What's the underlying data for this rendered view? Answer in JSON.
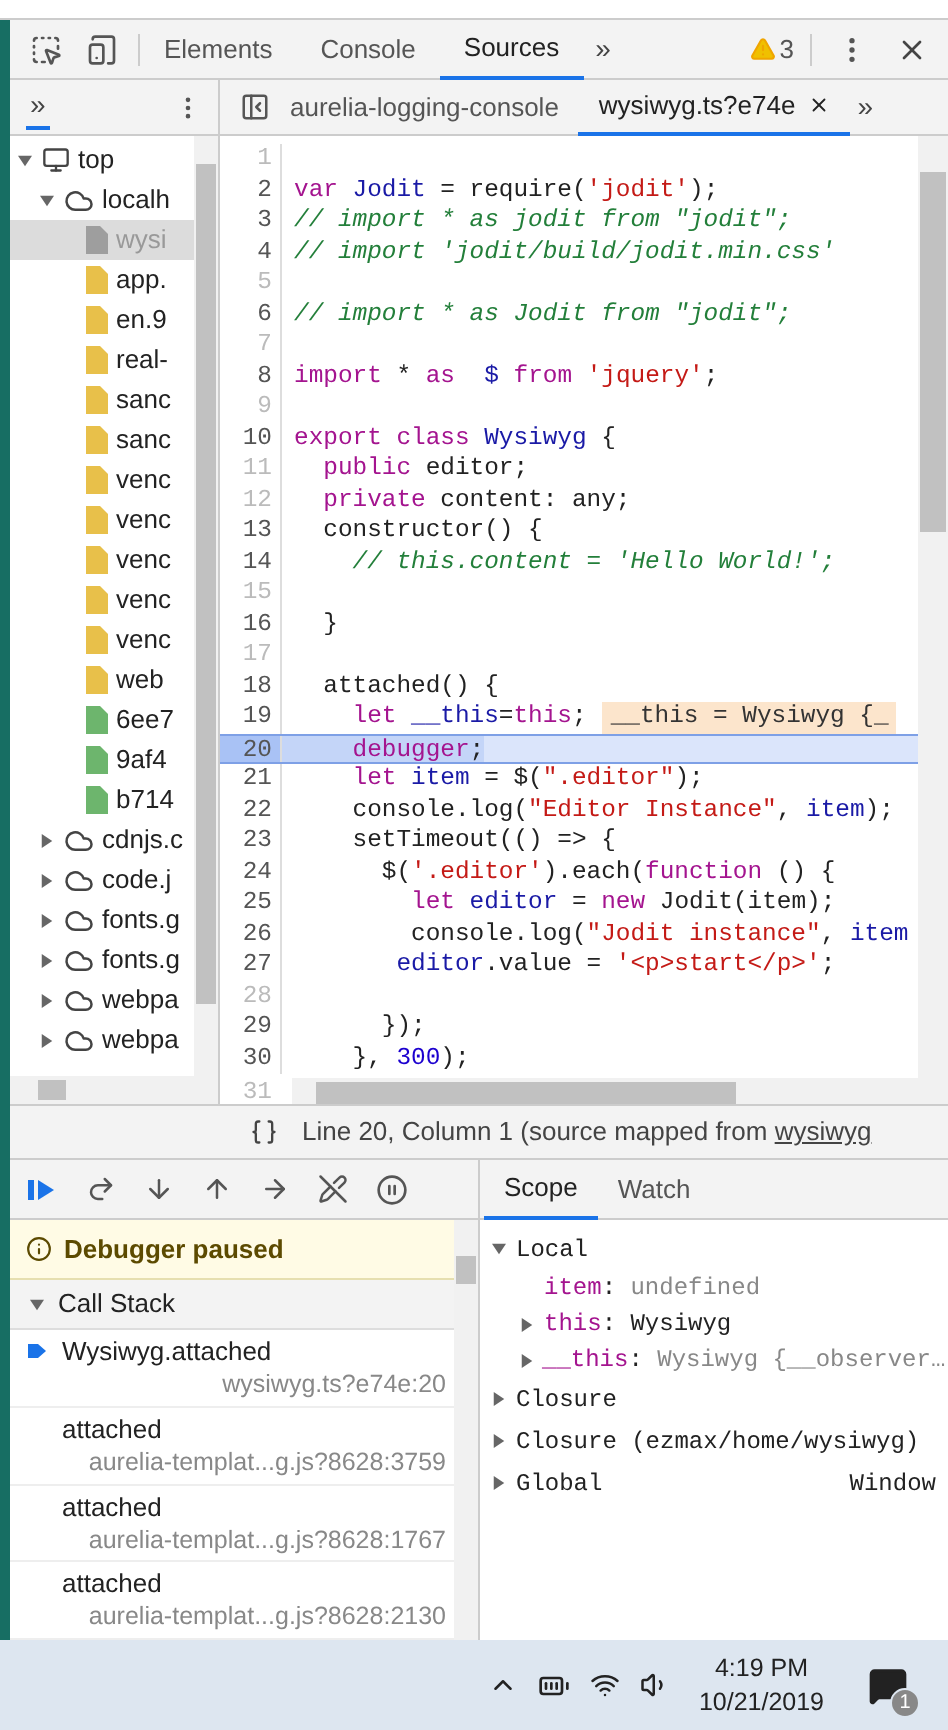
{
  "toolbar": {
    "tabs": [
      {
        "label": "Elements",
        "selected": false
      },
      {
        "label": "Console",
        "selected": false
      },
      {
        "label": "Sources",
        "selected": true
      }
    ],
    "overflow": "»",
    "warnings": "3"
  },
  "navigator": {
    "overflow": "»",
    "tree": [
      {
        "label": "top",
        "kind": "frame",
        "expanded": true,
        "selected": false,
        "children": [
          {
            "label": "localh",
            "kind": "domain",
            "expanded": true,
            "selected": false,
            "children": [
              {
                "label": "wysi",
                "kind": "file",
                "selected": true,
                "color": "#9e9e9e"
              },
              {
                "label": "app.",
                "kind": "file",
                "selected": false,
                "color": "#e8c04a"
              },
              {
                "label": "en.9",
                "kind": "file",
                "selected": false,
                "color": "#e8c04a"
              },
              {
                "label": "real-",
                "kind": "file",
                "selected": false,
                "color": "#e8c04a"
              },
              {
                "label": "sanc",
                "kind": "file",
                "selected": false,
                "color": "#e8c04a"
              },
              {
                "label": "sanc",
                "kind": "file",
                "selected": false,
                "color": "#e8c04a"
              },
              {
                "label": "venc",
                "kind": "file",
                "selected": false,
                "color": "#e8c04a"
              },
              {
                "label": "venc",
                "kind": "file",
                "selected": false,
                "color": "#e8c04a"
              },
              {
                "label": "venc",
                "kind": "file",
                "selected": false,
                "color": "#e8c04a"
              },
              {
                "label": "venc",
                "kind": "file",
                "selected": false,
                "color": "#e8c04a"
              },
              {
                "label": "venc",
                "kind": "file",
                "selected": false,
                "color": "#e8c04a"
              },
              {
                "label": "web",
                "kind": "file",
                "selected": false,
                "color": "#e8c04a"
              },
              {
                "label": "6ee7",
                "kind": "file",
                "selected": false,
                "color": "#6db56d"
              },
              {
                "label": "9af4",
                "kind": "file",
                "selected": false,
                "color": "#6db56d"
              },
              {
                "label": "b714",
                "kind": "file",
                "selected": false,
                "color": "#6db56d"
              }
            ]
          },
          {
            "label": "cdnjs.c",
            "kind": "domain",
            "expanded": false,
            "selected": false
          },
          {
            "label": "code.j",
            "kind": "domain",
            "expanded": false,
            "selected": false
          },
          {
            "label": "fonts.g",
            "kind": "domain",
            "expanded": false,
            "selected": false
          },
          {
            "label": "fonts.g",
            "kind": "domain",
            "expanded": false,
            "selected": false
          },
          {
            "label": "webpa",
            "kind": "domain",
            "expanded": false,
            "selected": false
          },
          {
            "label": "webpa",
            "kind": "domain",
            "expanded": false,
            "selected": false
          }
        ]
      }
    ]
  },
  "editor": {
    "tabs": [
      {
        "label": "aurelia-logging-console",
        "selected": false
      },
      {
        "label": "wysiwyg.ts?e74e",
        "selected": true
      }
    ],
    "overflow": "»",
    "lines": [
      {
        "number": "1",
        "mapped": false,
        "paused": false
      },
      {
        "number": "2",
        "mapped": true,
        "paused": false,
        "tokens": [
          {
            "kind": "keyword",
            "text": "var"
          },
          {
            "kind": "def",
            "text": " Jodit"
          },
          {
            "kind": "plain",
            "text": " = require("
          },
          {
            "kind": "string",
            "text": "'jodit'"
          },
          {
            "kind": "plain",
            "text": ");"
          }
        ]
      },
      {
        "number": "3",
        "mapped": true,
        "paused": false,
        "tokens": [
          {
            "kind": "comment",
            "text": "// import * as jodit from \"jodit\";"
          }
        ]
      },
      {
        "number": "4",
        "mapped": true,
        "paused": false,
        "tokens": [
          {
            "kind": "comment",
            "text": "// import 'jodit/build/jodit.min.css'"
          }
        ]
      },
      {
        "number": "5",
        "mapped": false,
        "paused": false
      },
      {
        "number": "6",
        "mapped": true,
        "paused": false,
        "tokens": [
          {
            "kind": "comment",
            "text": "// import * as Jodit from \"jodit\";"
          }
        ]
      },
      {
        "number": "7",
        "mapped": false,
        "paused": false
      },
      {
        "number": "8",
        "mapped": true,
        "paused": false,
        "tokens": [
          {
            "kind": "keyword",
            "text": "import"
          },
          {
            "kind": "plain",
            "text": " * "
          },
          {
            "kind": "keyword",
            "text": "as"
          },
          {
            "kind": "def",
            "text": "  $"
          },
          {
            "kind": "keyword",
            "text": " from"
          },
          {
            "kind": "string",
            "text": " 'jquery'"
          },
          {
            "kind": "plain",
            "text": ";"
          }
        ]
      },
      {
        "number": "9",
        "mapped": false,
        "paused": false
      },
      {
        "number": "10",
        "mapped": true,
        "paused": false,
        "tokens": [
          {
            "kind": "keyword",
            "text": "export class"
          },
          {
            "kind": "def",
            "text": " Wysiwyg"
          },
          {
            "kind": "plain",
            "text": " {"
          }
        ]
      },
      {
        "number": "11",
        "mapped": false,
        "paused": false,
        "tokens": [
          {
            "kind": "keyword",
            "text": "  public"
          },
          {
            "kind": "plain",
            "text": " editor;"
          }
        ]
      },
      {
        "number": "12",
        "mapped": false,
        "paused": false,
        "tokens": [
          {
            "kind": "keyword",
            "text": "  private"
          },
          {
            "kind": "plain",
            "text": " content: any;"
          }
        ]
      },
      {
        "number": "13",
        "mapped": true,
        "paused": false,
        "tokens": [
          {
            "kind": "plain",
            "text": "  constructor() {"
          }
        ]
      },
      {
        "number": "14",
        "mapped": true,
        "paused": false,
        "tokens": [
          {
            "kind": "comment",
            "text": "    // this.content = 'Hello World!';"
          }
        ]
      },
      {
        "number": "15",
        "mapped": false,
        "paused": false
      },
      {
        "number": "16",
        "mapped": true,
        "paused": false,
        "tokens": [
          {
            "kind": "plain",
            "text": "  }"
          }
        ]
      },
      {
        "number": "17",
        "mapped": false,
        "paused": false
      },
      {
        "number": "18",
        "mapped": true,
        "paused": false,
        "tokens": [
          {
            "kind": "plain",
            "text": "  attached() {"
          }
        ]
      },
      {
        "number": "19",
        "mapped": true,
        "paused": false,
        "tokens": [
          {
            "kind": "keyword",
            "text": "    let"
          },
          {
            "kind": "def",
            "text": " __this"
          },
          {
            "kind": "plain",
            "text": "="
          },
          {
            "kind": "keyword",
            "text": "this"
          },
          {
            "kind": "plain",
            "text": ";"
          }
        ],
        "inline_value": "__this = Wysiwyg {_"
      },
      {
        "number": "20",
        "mapped": true,
        "paused": true,
        "tokens": [
          {
            "kind": "keyword",
            "text": "    debugger"
          },
          {
            "kind": "plain",
            "text": ";"
          }
        ]
      },
      {
        "number": "21",
        "mapped": true,
        "paused": false,
        "tokens": [
          {
            "kind": "keyword",
            "text": "    let"
          },
          {
            "kind": "def",
            "text": " item"
          },
          {
            "kind": "plain",
            "text": " = $("
          },
          {
            "kind": "string",
            "text": "\".editor\""
          },
          {
            "kind": "plain",
            "text": ");"
          }
        ]
      },
      {
        "number": "22",
        "mapped": true,
        "paused": false,
        "tokens": [
          {
            "kind": "plain",
            "text": "    console.log("
          },
          {
            "kind": "string",
            "text": "\"Editor Instance\""
          },
          {
            "kind": "plain",
            "text": ", "
          },
          {
            "kind": "def",
            "text": "item"
          },
          {
            "kind": "plain",
            "text": ");"
          }
        ]
      },
      {
        "number": "23",
        "mapped": true,
        "paused": false,
        "tokens": [
          {
            "kind": "plain",
            "text": "    setTimeout(() => {"
          }
        ]
      },
      {
        "number": "24",
        "mapped": true,
        "paused": false,
        "tokens": [
          {
            "kind": "plain",
            "text": "      $("
          },
          {
            "kind": "string",
            "text": "'.editor'"
          },
          {
            "kind": "plain",
            "text": ").each("
          },
          {
            "kind": "keyword",
            "text": "function"
          },
          {
            "kind": "plain",
            "text": " () {"
          }
        ]
      },
      {
        "number": "25",
        "mapped": true,
        "paused": false,
        "tokens": [
          {
            "kind": "keyword",
            "text": "        let"
          },
          {
            "kind": "def",
            "text": " editor"
          },
          {
            "kind": "plain",
            "text": " = "
          },
          {
            "kind": "keyword",
            "text": "new"
          },
          {
            "kind": "plain",
            "text": " Jodit(item);"
          }
        ]
      },
      {
        "number": "26",
        "mapped": true,
        "paused": false,
        "tokens": [
          {
            "kind": "plain",
            "text": "        console.log("
          },
          {
            "kind": "string",
            "text": "\"Jodit instance\""
          },
          {
            "kind": "plain",
            "text": ", "
          },
          {
            "kind": "def",
            "text": "item"
          }
        ]
      },
      {
        "number": "27",
        "mapped": true,
        "paused": false,
        "tokens": [
          {
            "kind": "def",
            "text": "       editor"
          },
          {
            "kind": "plain",
            "text": ".value = "
          },
          {
            "kind": "string",
            "text": "'<p>start</p>'"
          },
          {
            "kind": "plain",
            "text": ";"
          }
        ]
      },
      {
        "number": "28",
        "mapped": false,
        "paused": false
      },
      {
        "number": "29",
        "mapped": true,
        "paused": false,
        "tokens": [
          {
            "kind": "plain",
            "text": "      });"
          }
        ]
      },
      {
        "number": "30",
        "mapped": true,
        "paused": false,
        "tokens": [
          {
            "kind": "plain",
            "text": "    }, "
          },
          {
            "kind": "number",
            "text": "300"
          },
          {
            "kind": "plain",
            "text": ");"
          }
        ]
      },
      {
        "number": "31",
        "mapped": false,
        "paused": false
      }
    ]
  },
  "status_bar": {
    "position": "Line 20, Column 1",
    "source_prefix": "(source mapped from",
    "source_link": "wysiwyg"
  },
  "debugger": {
    "paused_message": "Debugger paused",
    "call_stack_title": "Call Stack",
    "call_stack_expanded": true,
    "frames": [
      {
        "name": "Wysiwyg.attached",
        "location": "wysiwyg.ts?e74e:20",
        "selected": true
      },
      {
        "name": "attached",
        "location": "aurelia-templat...g.js?8628:3759",
        "selected": false
      },
      {
        "name": "attached",
        "location": "aurelia-templat...g.js?8628:1767",
        "selected": false
      },
      {
        "name": "attached",
        "location": "aurelia-templat...g.js?8628:2130",
        "selected": false
      }
    ],
    "tabs": [
      {
        "label": "Scope",
        "selected": true
      },
      {
        "label": "Watch",
        "selected": false
      }
    ],
    "scope": [
      {
        "label": "Local",
        "expanded": true,
        "children": [
          {
            "name": "item",
            "separator": ":",
            "value": "undefined",
            "kind": "undefined"
          },
          {
            "name": "this",
            "separator": ":",
            "value": "Wysiwyg",
            "kind": "object"
          },
          {
            "name": "__this",
            "separator": ":",
            "value": "Wysiwyg {__observer…",
            "kind": "preview"
          }
        ]
      },
      {
        "label": "Closure",
        "expanded": false
      },
      {
        "label": "Closure (ezmax/home/wysiwyg)",
        "expanded": false
      },
      {
        "label": "Global",
        "expanded": false,
        "value": "Window"
      }
    ]
  },
  "taskbar": {
    "time": "4:19 PM",
    "date": "10/21/2019",
    "notifications": "1"
  }
}
